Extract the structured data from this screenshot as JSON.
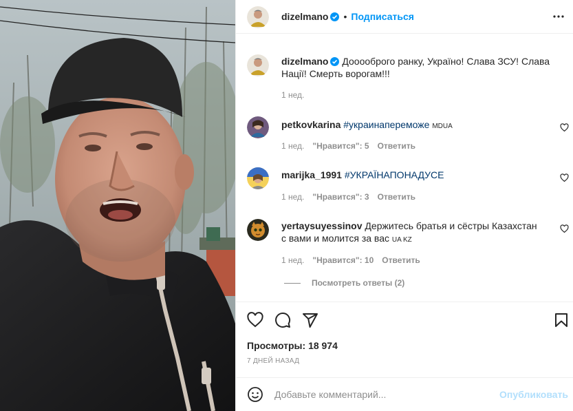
{
  "post": {
    "username": "dizelmano",
    "follow_label": "Подписаться",
    "dot": "•",
    "caption_text": "Дооооброго ранку, Україно! Слава ЗСУ! Слава Нації! Смерть ворогам!!!",
    "caption_time": "1 нед."
  },
  "comments": [
    {
      "username": "petkovkarina",
      "text": "#украинапереможе MD⁠UA",
      "tag": "#украинапереможе",
      "suffix": "MD⁠UA",
      "time": "1 нед.",
      "likes": "\"Нравится\": 5",
      "reply_label": "Ответить"
    },
    {
      "username": "marijka_1991",
      "tag": "#УКРАЇНАПОНАДУСЕ",
      "time": "1 нед.",
      "likes": "\"Нравится\": 3",
      "reply_label": "Ответить"
    },
    {
      "username": "yertaysuyessinov",
      "text": "Держитесь братья и сёстры Казахстан с вами и молится за вас",
      "suffix": "UA KZ",
      "time": "1 нед.",
      "likes": "\"Нравится\": 10",
      "reply_label": "Ответить"
    }
  ],
  "view_replies": "Посмотреть ответы (2)",
  "views_label": "Просмотры:",
  "views_count": "18 974",
  "date": "7 ДНЕЙ НАЗАД",
  "add_comment": {
    "placeholder": "Добавьте комментарий...",
    "publish_label": "Опубликовать"
  },
  "colors": {
    "accent": "#0095f6",
    "publish_disabled": "#b2dffc",
    "secondary_text": "#8e8e8e",
    "hashtag": "#00376b"
  },
  "icons": [
    "verified-badge-icon",
    "more-options-icon",
    "heart-icon",
    "comment-icon",
    "share-icon",
    "bookmark-icon",
    "emoji-icon"
  ]
}
